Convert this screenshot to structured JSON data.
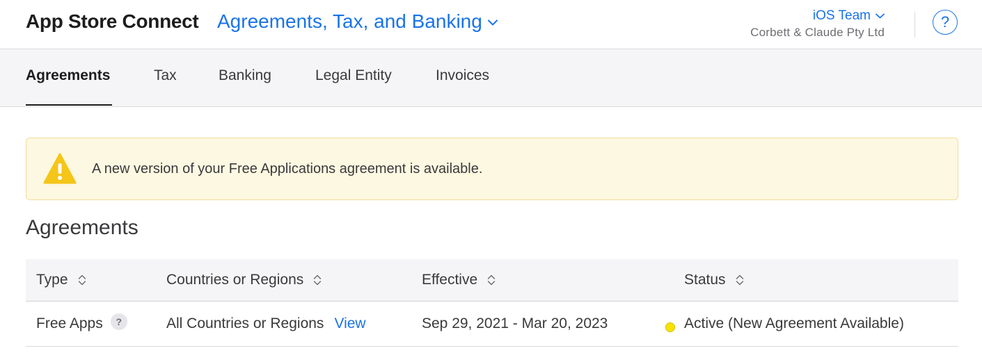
{
  "header": {
    "app_title": "App Store Connect",
    "section": "Agreements, Tax, and Banking",
    "team": "iOS Team",
    "organization": "Corbett & Claude Pty Ltd",
    "help_label": "?"
  },
  "tabs": [
    {
      "label": "Agreements",
      "active": true
    },
    {
      "label": "Tax",
      "active": false
    },
    {
      "label": "Banking",
      "active": false
    },
    {
      "label": "Legal Entity",
      "active": false
    },
    {
      "label": "Invoices",
      "active": false
    }
  ],
  "alert": {
    "icon": "warning-icon",
    "message": "A new version of your Free Applications agreement is available."
  },
  "agreements": {
    "heading": "Agreements",
    "columns": [
      "Type",
      "Countries or Regions",
      "Effective",
      "Status"
    ],
    "rows": [
      {
        "type": "Free Apps",
        "help_badge": "?",
        "regions": "All Countries or Regions",
        "view_link": "View",
        "effective": "Sep 29, 2021 - Mar 20, 2023",
        "status": "Active (New Agreement Available)",
        "status_color": "#f7e200"
      }
    ]
  },
  "colors": {
    "accent": "#1a73e8",
    "alert_background": "#fdf8e1",
    "warning": "#f5c518"
  }
}
